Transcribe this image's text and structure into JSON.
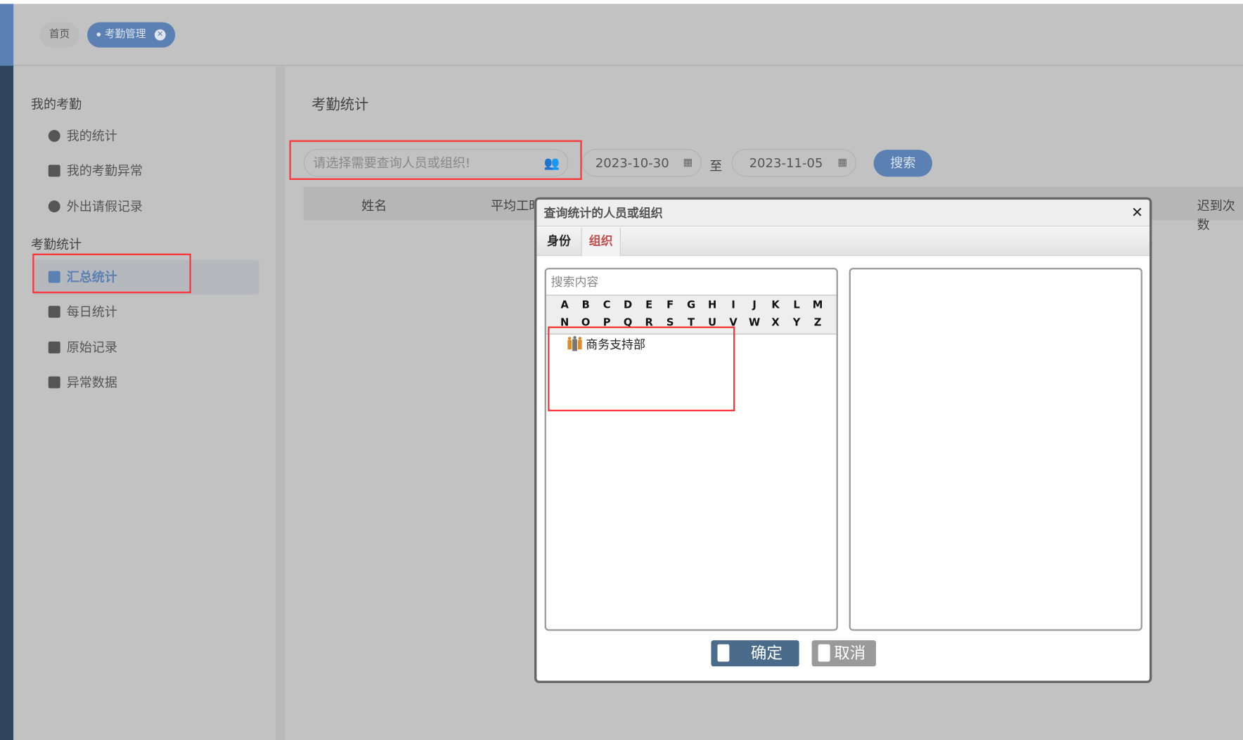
{
  "tabs": [
    {
      "label": "首页"
    },
    {
      "label": "考勤管理"
    }
  ],
  "sidebar": {
    "sections": [
      {
        "title": "我的考勤",
        "items": [
          {
            "label": "我的统计",
            "icon": "pie-chart-icon"
          },
          {
            "label": "我的考勤异常",
            "icon": "calendar-alert-icon"
          },
          {
            "label": "外出请假记录",
            "icon": "clock-icon"
          }
        ]
      },
      {
        "title": "考勤统计",
        "items": [
          {
            "label": "汇总统计",
            "icon": "chart-icon",
            "active": true
          },
          {
            "label": "每日统计",
            "icon": "folder-icon"
          },
          {
            "label": "原始记录",
            "icon": "document-icon"
          },
          {
            "label": "异常数据",
            "icon": "calendar-alert-icon"
          }
        ]
      }
    ]
  },
  "main": {
    "title": "考勤统计",
    "person_placeholder": "请选择需要查询人员或组织!",
    "date_from": "2023-10-30",
    "date_sep": "至",
    "date_to": "2023-11-05",
    "search_label": "搜索",
    "columns": [
      "姓名",
      "平均工时",
      "迟到次数"
    ]
  },
  "dialog": {
    "title": "查询统计的人员或组织",
    "close": "✕",
    "tabs": [
      {
        "label": "身份"
      },
      {
        "label": "组织",
        "active": true
      }
    ],
    "search_placeholder": "搜索内容",
    "letters_row1": [
      "A",
      "B",
      "C",
      "D",
      "E",
      "F",
      "G",
      "H",
      "I",
      "J",
      "K",
      "L",
      "M"
    ],
    "letters_row2": [
      "N",
      "O",
      "P",
      "Q",
      "R",
      "S",
      "T",
      "U",
      "V",
      "W",
      "X",
      "Y",
      "Z"
    ],
    "org_items": [
      "商务支持部"
    ],
    "confirm_label": "确定",
    "cancel_label": "取消"
  },
  "colors": {
    "accent": "#5a80b4",
    "highlight": "#ff3333",
    "confirm": "#4a6b8a",
    "cancel": "#9a9a9a",
    "tab_active": "#c0504d"
  }
}
